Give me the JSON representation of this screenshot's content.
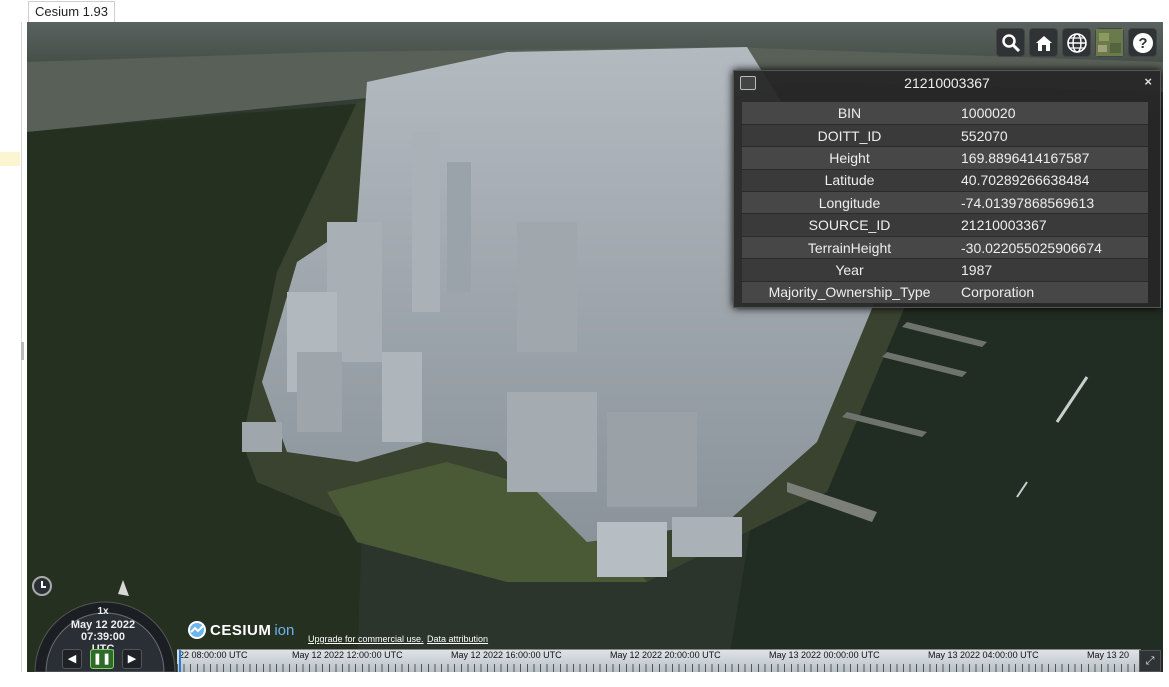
{
  "tab": {
    "label": "Cesium 1.93"
  },
  "toolbar": {
    "buttons": [
      {
        "name": "geocoder-search-button",
        "icon": "search-icon"
      },
      {
        "name": "home-button",
        "icon": "home-icon"
      },
      {
        "name": "scene-mode-button",
        "icon": "globe-icon"
      },
      {
        "name": "base-layer-picker-button",
        "icon": "imagery-thumbnail-icon"
      },
      {
        "name": "help-button",
        "icon": "question-icon"
      }
    ]
  },
  "infobox": {
    "title": "21210003367",
    "close_label": "×",
    "rows": [
      {
        "key": "BIN",
        "value": "1000020"
      },
      {
        "key": "DOITT_ID",
        "value": "552070"
      },
      {
        "key": "Height",
        "value": "169.8896414167587"
      },
      {
        "key": "Latitude",
        "value": "40.70289266638484"
      },
      {
        "key": "Longitude",
        "value": "-74.01397868569613"
      },
      {
        "key": "SOURCE_ID",
        "value": "21210003367"
      },
      {
        "key": "TerrainHeight",
        "value": "-30.022055025906674"
      },
      {
        "key": "Year",
        "value": "1987"
      },
      {
        "key": "Majority_Ownership_Type",
        "value": "Corporation"
      }
    ]
  },
  "animation": {
    "speed": "1x",
    "date": "May 12 2022",
    "time": "07:39:00 UTC"
  },
  "credits": {
    "logo_main": "CESIUM",
    "logo_sub": "ion",
    "upgrade": "Upgrade for commercial use.",
    "attribution": "Data attribution"
  },
  "timeline": {
    "labels": [
      "22 08:00:00 UTC",
      "May 12 2022 12:00:00 UTC",
      "May 12 2022 16:00:00 UTC",
      "May 12 2022 20:00:00 UTC",
      "May 13 2022 00:00:00 UTC",
      "May 13 2022 04:00:00 UTC",
      "May 13 20"
    ]
  },
  "colors": {
    "panel": "#303336",
    "buildings": "#9ba4ab",
    "water": "#2c352b",
    "ion_blue": "#6cb5f0"
  }
}
